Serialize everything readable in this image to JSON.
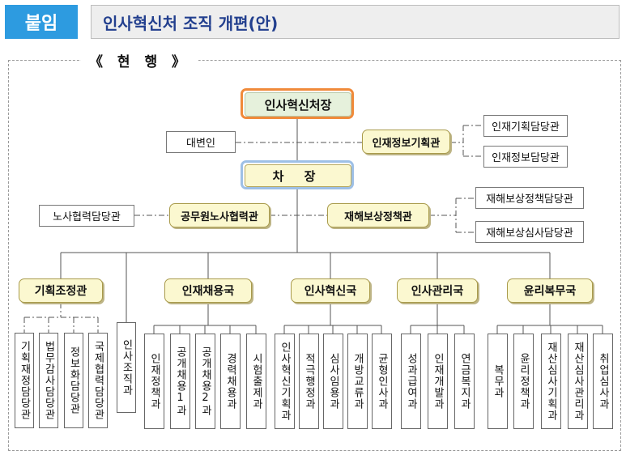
{
  "header": {
    "tag": "붙임",
    "title": "인사혁신처 조직 개편(안)"
  },
  "section_label": "《 현  행 》",
  "org": {
    "minister": "인사혁신처장",
    "spokesperson": "대변인",
    "planning_officer": "인재정보기획관",
    "planning_subunits": [
      "인재기획담당관",
      "인재정보담당관"
    ],
    "vice_minister": "차  장",
    "labor_officer": "공무원노사협력관",
    "labor_subunit": "노사협력담당관",
    "compensation_officer": "재해보상정책관",
    "compensation_subunits": [
      "재해보상정책담당관",
      "재해보상심사담당관"
    ],
    "bureaus": [
      {
        "name": "기획조정관",
        "units": [
          "기획재정담당관",
          "법무감사담당관",
          "정보화담당관",
          "국제협력담당관"
        ]
      },
      {
        "name": "인재채용국",
        "units": [
          "인재정책과",
          "공개채용1과",
          "공개채용2과",
          "경력채용과",
          "시험출제과"
        ]
      },
      {
        "name": "인사혁신국",
        "units": [
          "인사혁신기획과",
          "적극행정과",
          "심사임용과",
          "개방교류과",
          "균형인사과"
        ]
      },
      {
        "name": "인사관리국",
        "units": [
          "성과급여과",
          "인재개발과",
          "연금복지과"
        ]
      },
      {
        "name": "윤리복무국",
        "units": [
          "복무과",
          "윤리정책과",
          "재산심사기획과",
          "재산심사관리과",
          "취업심사과"
        ]
      }
    ],
    "standalone_unit": "인사조직과"
  }
}
